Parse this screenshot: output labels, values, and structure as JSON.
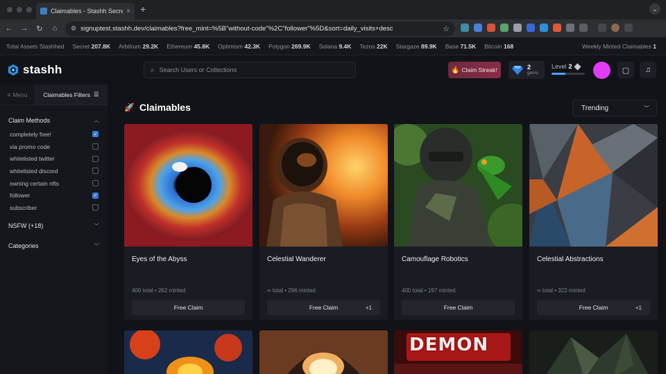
{
  "browser": {
    "tab_title": "Claimables - Stashh Secret N",
    "tab_close": "×",
    "new_tab": "+",
    "url": "signuptest.stashh.dev/claimables?free_mint=%5B\"without-code\"%2C\"follower\"%5D&sort=daily_visits+desc"
  },
  "ticker": {
    "items": [
      {
        "label": "Total Assets Stashhed",
        "value": ""
      },
      {
        "label": "Secret",
        "value": "207.8K"
      },
      {
        "label": "Arbitrum",
        "value": "29.2K"
      },
      {
        "label": "Ethereum",
        "value": "45.8K"
      },
      {
        "label": "Optimism",
        "value": "42.3K"
      },
      {
        "label": "Polygon",
        "value": "269.9K"
      },
      {
        "label": "Solana",
        "value": "9.4K"
      },
      {
        "label": "Tezos",
        "value": "22K"
      },
      {
        "label": "Stargaze",
        "value": "89.9K"
      },
      {
        "label": "Base",
        "value": "71.5K"
      },
      {
        "label": "Bitcoin",
        "value": "168"
      }
    ],
    "weekly_label": "Weekly Minted Claimables",
    "weekly_value": "1"
  },
  "header": {
    "logo_text": "stashh",
    "search_placeholder": "Search Users or Collections",
    "streak_label": "Claim Streak!",
    "gems_count": "2",
    "gems_label": "gems",
    "level_label": "Level",
    "level_value": "2",
    "level_progress": 0.42,
    "avatar_color": "#e13cf5"
  },
  "sidebar": {
    "menu_label": "Menu",
    "filters_label": "Claimables Filters",
    "claim_methods_title": "Claim Methods",
    "claim_methods": [
      {
        "label": "completely free!",
        "checked": true
      },
      {
        "label": "via promo code",
        "checked": false
      },
      {
        "label": "whitelisted twitter",
        "checked": false
      },
      {
        "label": "whitelisted discord",
        "checked": false
      },
      {
        "label": "owning certain nfts",
        "checked": false
      },
      {
        "label": "follower",
        "checked": true
      },
      {
        "label": "subscriber",
        "checked": false
      }
    ],
    "nsfw_title": "NSFW (+18)",
    "categories_title": "Categories"
  },
  "main": {
    "title": "Claimables",
    "sort_value": "Trending",
    "cards": [
      {
        "name": "Eyes of the Abyss",
        "meta": "400 total • 262 minted",
        "claim_label": "Free Claim",
        "extra": ""
      },
      {
        "name": "Celestial Wanderer",
        "meta": "∞ total • 296 minted",
        "claim_label": "Free Claim",
        "extra": "+1"
      },
      {
        "name": "Camouflage Robotics",
        "meta": "400 total • 197 minted",
        "claim_label": "Free Claim",
        "extra": ""
      },
      {
        "name": "Celestial Abstractions",
        "meta": "∞ total • 322 minted",
        "claim_label": "Free Claim",
        "extra": "+1"
      }
    ],
    "second_row_text": "DEMON"
  },
  "colors": {
    "accent": "#3a7bd5",
    "background": "#111318",
    "sidebar": "#15171c",
    "card": "#191c22"
  }
}
